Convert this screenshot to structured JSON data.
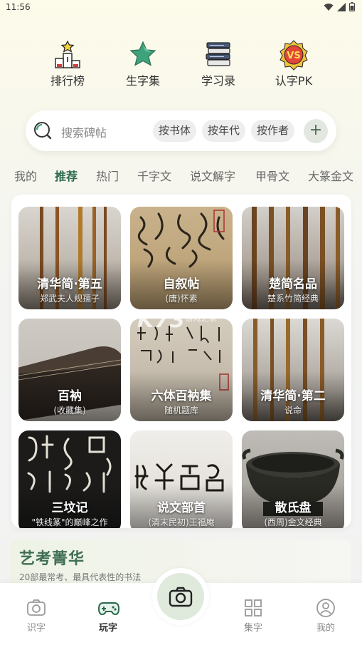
{
  "status": {
    "time": "11:56"
  },
  "quick": [
    {
      "label": "排行榜",
      "icon": "podium-star-icon"
    },
    {
      "label": "生字集",
      "icon": "star-icon"
    },
    {
      "label": "学习录",
      "icon": "book-stack-icon"
    },
    {
      "label": "认字PK",
      "icon": "vs-badge-icon"
    }
  ],
  "search": {
    "placeholder": "搜索碑帖",
    "chips": [
      "按书体",
      "按年代",
      "按作者"
    ],
    "plus": "+"
  },
  "tabs": [
    "我的",
    "推荐",
    "热门",
    "千字文",
    "说文解字",
    "甲骨文",
    "大篆金文"
  ],
  "active_tab": "推荐",
  "tiles": [
    {
      "title": "清华简·第五",
      "sub": "郑武夫人规孺子"
    },
    {
      "title": "自叙帖",
      "sub": "(唐)怀素"
    },
    {
      "title": "楚简名品",
      "sub": "楚系竹简经典"
    },
    {
      "title": "百衲",
      "sub": "(收藏集)"
    },
    {
      "title": "六体百衲集",
      "sub": "随机题库"
    },
    {
      "title": "清华简·第二",
      "sub": "说命"
    },
    {
      "title": "三坟记",
      "sub": "\"铁线篆\"的巅峰之作"
    },
    {
      "title": "说文部首",
      "sub": "(清末民初)王福庵"
    },
    {
      "title": "散氏盘",
      "sub": "(西周)金文经典"
    }
  ],
  "watermark": {
    "big": "K73",
    "small": "游戏之家"
  },
  "feature": {
    "title": "艺考菁华",
    "sub": "20部最常考、最具代表性的书法"
  },
  "nav": [
    {
      "label": "识字",
      "icon": "camera-outline-icon"
    },
    {
      "label": "玩字",
      "icon": "gamepad-icon"
    },
    {
      "label": "集字",
      "icon": "grid-icon"
    },
    {
      "label": "我的",
      "icon": "profile-icon"
    }
  ],
  "colors": {
    "accent": "#2b6a4a",
    "camera_bg": "#dfe9dc"
  }
}
